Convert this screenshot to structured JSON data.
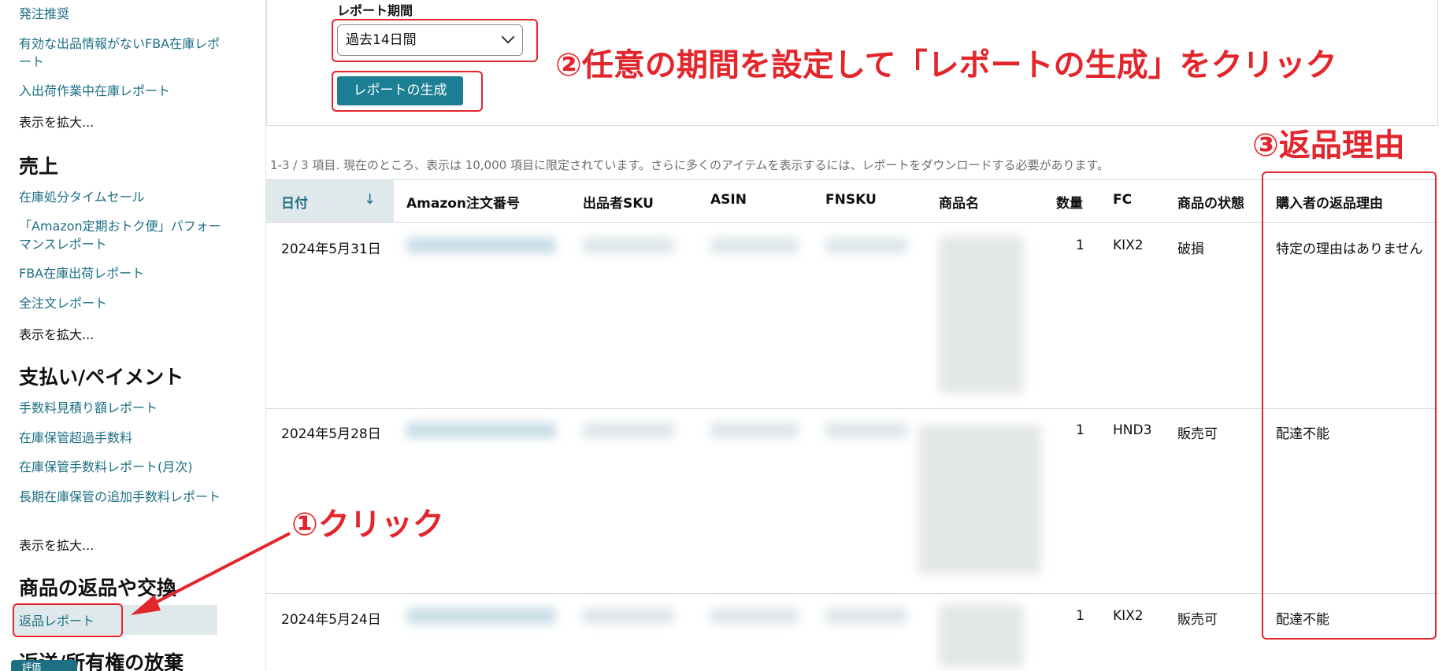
{
  "sidebar": {
    "links_top": [
      "発注推奨",
      "有効な出品情報がないFBA在庫レポート",
      "入出荷作業中在庫レポート"
    ],
    "more": "表示を拡大...",
    "sections": [
      {
        "heading": "売上",
        "links": [
          "在庫処分タイムセール",
          "「Amazon定期おトク便」パフォーマンスレポート",
          "FBA在庫出荷レポート",
          "全注文レポート"
        ]
      },
      {
        "heading": "支払い/ペイメント",
        "links": [
          "手数料見積り額レポート",
          "在庫保管超過手数料",
          "在庫保管手数料レポート(月次)",
          "長期在庫保管の追加手数料レポート"
        ]
      },
      {
        "heading": "商品の返品や交換",
        "links": [
          "返品レポート"
        ]
      },
      {
        "heading": "返送/所有権の放棄",
        "links": []
      }
    ],
    "tag_label": "評価"
  },
  "form": {
    "period_label": "レポート期間",
    "period_value": "過去14日間",
    "generate_label": "レポートの生成"
  },
  "table": {
    "summary": "1-3 / 3 項目. 現在のところ、表示は 10,000 項目に限定されています。さらに多くのアイテムを表示するには、レポートをダウンロードする必要があります。",
    "columns": [
      "日付",
      "Amazon注文番号",
      "出品者SKU",
      "ASIN",
      "FNSKU",
      "商品名",
      "数量",
      "FC",
      "商品の状態",
      "購入者の返品理由"
    ],
    "rows": [
      {
        "date": "2024年5月31日",
        "qty": "1",
        "fc": "KIX2",
        "condition": "破損",
        "reason": "特定の理由はありません"
      },
      {
        "date": "2024年5月28日",
        "qty": "1",
        "fc": "HND3",
        "condition": "販売可",
        "reason": "配達不能"
      },
      {
        "date": "2024年5月24日",
        "qty": "1",
        "fc": "KIX2",
        "condition": "販売可",
        "reason": "配達不能"
      }
    ]
  },
  "annotations": {
    "step1": "①クリック",
    "step2": "②任意の期間を設定して「レポートの生成」をクリック",
    "step3": "③返品理由"
  },
  "colors": {
    "link": "#1d6f84",
    "button": "#1d7f94",
    "annotation": "#e3252c",
    "active_bg": "#dfe8ea"
  }
}
